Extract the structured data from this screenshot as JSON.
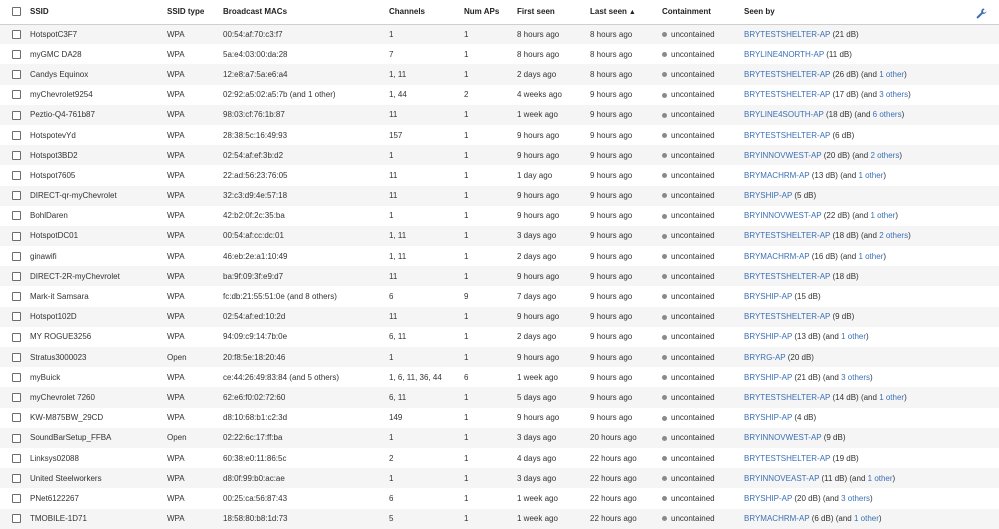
{
  "columns": {
    "ssid": "SSID",
    "ssid_type": "SSID type",
    "macs": "Broadcast MACs",
    "channels": "Channels",
    "num_aps": "Num APs",
    "first_seen": "First seen",
    "last_seen": "Last seen",
    "last_seen_sort": "▲",
    "containment": "Containment",
    "seen_by": "Seen by"
  },
  "accent_link_color": "#3b70b5",
  "header_icon": "wrench-icon",
  "rows": [
    {
      "ssid": "HotspotC3F7",
      "type": "WPA",
      "macs": "00:54:af:70:c3:f7",
      "channels": "1",
      "aps": "1",
      "first": "8 hours ago",
      "last": "8 hours ago",
      "containment": "uncontained",
      "ap": "BRYTESTSHELTER-AP",
      "db": " (21 dB)",
      "and": "",
      "other": "",
      "close": ""
    },
    {
      "ssid": "myGMC DA28",
      "type": "WPA",
      "macs": "5a:e4:03:00:da:28",
      "channels": "7",
      "aps": "1",
      "first": "8 hours ago",
      "last": "8 hours ago",
      "containment": "uncontained",
      "ap": "BRYLINE4NORTH-AP",
      "db": " (11 dB)",
      "and": "",
      "other": "",
      "close": ""
    },
    {
      "ssid": "Candys Equinox",
      "type": "WPA",
      "macs": "12:e8:a7:5a:e6:a4",
      "channels": "1, 11",
      "aps": "1",
      "first": "2 days ago",
      "last": "8 hours ago",
      "containment": "uncontained",
      "ap": "BRYTESTSHELTER-AP",
      "db": " (26 dB)",
      "and": " (and ",
      "other": "1 other",
      "close": ")"
    },
    {
      "ssid": "myChevrolet9254",
      "type": "WPA",
      "macs": "02:92:a5:02:a5:7b (and 1 other)",
      "channels": "1, 44",
      "aps": "2",
      "first": "4 weeks ago",
      "last": "9 hours ago",
      "containment": "uncontained",
      "ap": "BRYTESTSHELTER-AP",
      "db": " (17 dB)",
      "and": " (and ",
      "other": "3 others",
      "close": ")"
    },
    {
      "ssid": "Peztio-Q4-761b87",
      "type": "WPA",
      "macs": "98:03:cf:76:1b:87",
      "channels": "11",
      "aps": "1",
      "first": "1 week ago",
      "last": "9 hours ago",
      "containment": "uncontained",
      "ap": "BRYLINE4SOUTH-AP",
      "db": " (18 dB)",
      "and": " (and ",
      "other": "6 others",
      "close": ")"
    },
    {
      "ssid": "HotspotevYd",
      "type": "WPA",
      "macs": "28:38:5c:16:49:93",
      "channels": "157",
      "aps": "1",
      "first": "9 hours ago",
      "last": "9 hours ago",
      "containment": "uncontained",
      "ap": "BRYTESTSHELTER-AP",
      "db": " (6 dB)",
      "and": "",
      "other": "",
      "close": ""
    },
    {
      "ssid": "Hotspot3BD2",
      "type": "WPA",
      "macs": "02:54:af:ef:3b:d2",
      "channels": "1",
      "aps": "1",
      "first": "9 hours ago",
      "last": "9 hours ago",
      "containment": "uncontained",
      "ap": "BRYINNOVWEST-AP",
      "db": " (20 dB)",
      "and": " (and ",
      "other": "2 others",
      "close": ")"
    },
    {
      "ssid": "Hotspot7605",
      "type": "WPA",
      "macs": "22:ad:56:23:76:05",
      "channels": "11",
      "aps": "1",
      "first": "1 day ago",
      "last": "9 hours ago",
      "containment": "uncontained",
      "ap": "BRYMACHRM-AP",
      "db": " (13 dB)",
      "and": " (and ",
      "other": "1 other",
      "close": ")"
    },
    {
      "ssid": "DIRECT-qr-myChevrolet",
      "type": "WPA",
      "macs": "32:c3:d9:4e:57:18",
      "channels": "11",
      "aps": "1",
      "first": "9 hours ago",
      "last": "9 hours ago",
      "containment": "uncontained",
      "ap": "BRYSHIP-AP",
      "db": " (5 dB)",
      "and": "",
      "other": "",
      "close": ""
    },
    {
      "ssid": "BohlDaren",
      "type": "WPA",
      "macs": "42:b2:0f:2c:35:ba",
      "channels": "1",
      "aps": "1",
      "first": "9 hours ago",
      "last": "9 hours ago",
      "containment": "uncontained",
      "ap": "BRYINNOVWEST-AP",
      "db": " (22 dB)",
      "and": " (and ",
      "other": "1 other",
      "close": ")"
    },
    {
      "ssid": "HotspotDC01",
      "type": "WPA",
      "macs": "00:54:af:cc:dc:01",
      "channels": "1, 11",
      "aps": "1",
      "first": "3 days ago",
      "last": "9 hours ago",
      "containment": "uncontained",
      "ap": "BRYTESTSHELTER-AP",
      "db": " (18 dB)",
      "and": " (and ",
      "other": "2 others",
      "close": ")"
    },
    {
      "ssid": "ginawifi",
      "type": "WPA",
      "macs": "46:eb:2e:a1:10:49",
      "channels": "1, 11",
      "aps": "1",
      "first": "2 days ago",
      "last": "9 hours ago",
      "containment": "uncontained",
      "ap": "BRYMACHRM-AP",
      "db": " (16 dB)",
      "and": " (and ",
      "other": "1 other",
      "close": ")"
    },
    {
      "ssid": "DIRECT-2R-myChevrolet",
      "type": "WPA",
      "macs": "ba:9f:09:3f:e9:d7",
      "channels": "11",
      "aps": "1",
      "first": "9 hours ago",
      "last": "9 hours ago",
      "containment": "uncontained",
      "ap": "BRYTESTSHELTER-AP",
      "db": " (18 dB)",
      "and": "",
      "other": "",
      "close": ""
    },
    {
      "ssid": "Mark-it Samsara",
      "type": "WPA",
      "macs": "fc:db:21:55:51:0e (and 8 others)",
      "channels": "6",
      "aps": "9",
      "first": "7 days ago",
      "last": "9 hours ago",
      "containment": "uncontained",
      "ap": "BRYSHIP-AP",
      "db": " (15 dB)",
      "and": "",
      "other": "",
      "close": ""
    },
    {
      "ssid": "Hotspot102D",
      "type": "WPA",
      "macs": "02:54:af:ed:10:2d",
      "channels": "11",
      "aps": "1",
      "first": "9 hours ago",
      "last": "9 hours ago",
      "containment": "uncontained",
      "ap": "BRYTESTSHELTER-AP",
      "db": " (9 dB)",
      "and": "",
      "other": "",
      "close": ""
    },
    {
      "ssid": "MY ROGUE3256",
      "type": "WPA",
      "macs": "94:09:c9:14:7b:0e",
      "channels": "6, 11",
      "aps": "1",
      "first": "2 days ago",
      "last": "9 hours ago",
      "containment": "uncontained",
      "ap": "BRYSHIP-AP",
      "db": " (13 dB)",
      "and": " (and ",
      "other": "1 other",
      "close": ")"
    },
    {
      "ssid": "Stratus3000023",
      "type": "Open",
      "macs": "20:f8:5e:18:20:46",
      "channels": "1",
      "aps": "1",
      "first": "9 hours ago",
      "last": "9 hours ago",
      "containment": "uncontained",
      "ap": "BRYRG-AP",
      "db": " (20 dB)",
      "and": "",
      "other": "",
      "close": ""
    },
    {
      "ssid": "myBuick",
      "type": "WPA",
      "macs": "ce:44:26:49:83:84 (and 5 others)",
      "channels": "1, 6, 11, 36, 44",
      "aps": "6",
      "first": "1 week ago",
      "last": "9 hours ago",
      "containment": "uncontained",
      "ap": "BRYSHIP-AP",
      "db": " (21 dB)",
      "and": " (and ",
      "other": "3 others",
      "close": ")"
    },
    {
      "ssid": "myChevrolet 7260",
      "type": "WPA",
      "macs": "62:e6:f0:02:72:60",
      "channels": "6, 11",
      "aps": "1",
      "first": "5 days ago",
      "last": "9 hours ago",
      "containment": "uncontained",
      "ap": "BRYTESTSHELTER-AP",
      "db": " (14 dB)",
      "and": " (and ",
      "other": "1 other",
      "close": ")"
    },
    {
      "ssid": "KW-M875BW_29CD",
      "type": "WPA",
      "macs": "d8:10:68:b1:c2:3d",
      "channels": "149",
      "aps": "1",
      "first": "9 hours ago",
      "last": "9 hours ago",
      "containment": "uncontained",
      "ap": "BRYSHIP-AP",
      "db": " (4 dB)",
      "and": "",
      "other": "",
      "close": ""
    },
    {
      "ssid": "SoundBarSetup_FFBA",
      "type": "Open",
      "macs": "02:22:6c:17:ff:ba",
      "channels": "1",
      "aps": "1",
      "first": "3 days ago",
      "last": "20 hours ago",
      "containment": "uncontained",
      "ap": "BRYINNOVWEST-AP",
      "db": " (9 dB)",
      "and": "",
      "other": "",
      "close": ""
    },
    {
      "ssid": "Linksys02088",
      "type": "WPA",
      "macs": "60:38:e0:11:86:5c",
      "channels": "2",
      "aps": "1",
      "first": "4 days ago",
      "last": "22 hours ago",
      "containment": "uncontained",
      "ap": "BRYTESTSHELTER-AP",
      "db": " (19 dB)",
      "and": "",
      "other": "",
      "close": ""
    },
    {
      "ssid": "United Steelworkers",
      "type": "WPA",
      "macs": "d8:0f:99:b0:ac:ae",
      "channels": "1",
      "aps": "1",
      "first": "3 days ago",
      "last": "22 hours ago",
      "containment": "uncontained",
      "ap": "BRYINNOVEAST-AP",
      "db": " (11 dB)",
      "and": " (and ",
      "other": "1 other",
      "close": ")"
    },
    {
      "ssid": "PNet6122267",
      "type": "WPA",
      "macs": "00:25:ca:56:87:43",
      "channels": "6",
      "aps": "1",
      "first": "1 week ago",
      "last": "22 hours ago",
      "containment": "uncontained",
      "ap": "BRYSHIP-AP",
      "db": " (20 dB)",
      "and": " (and ",
      "other": "3 others",
      "close": ")"
    },
    {
      "ssid": "TMOBILE-1D71",
      "type": "WPA",
      "macs": "18:58:80:b8:1d:73",
      "channels": "5",
      "aps": "1",
      "first": "1 week ago",
      "last": "22 hours ago",
      "containment": "uncontained",
      "ap": "BRYMACHRM-AP",
      "db": " (6 dB)",
      "and": " (and ",
      "other": "1 other",
      "close": ")"
    }
  ]
}
